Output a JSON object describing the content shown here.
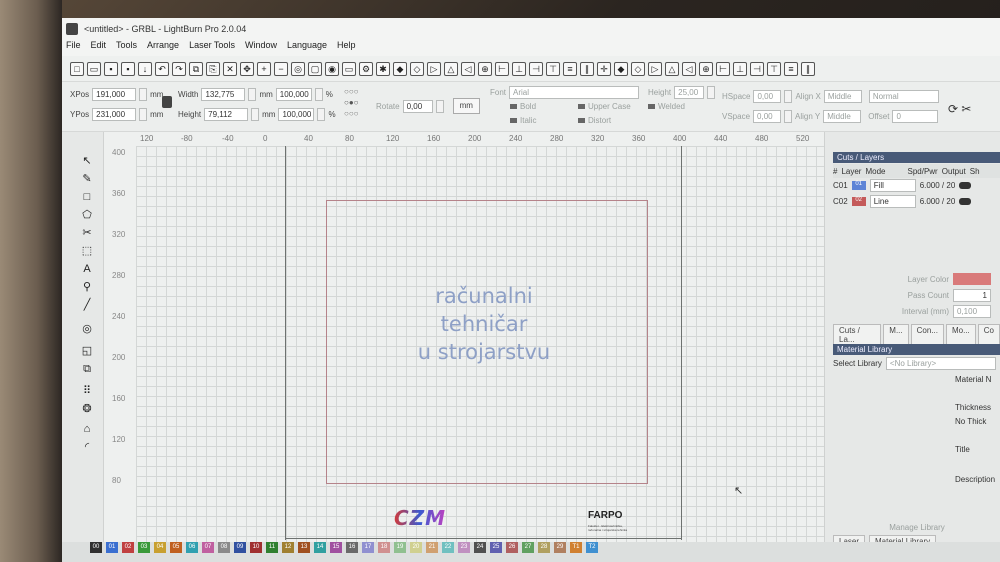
{
  "window": {
    "title": "<untitled> - GRBL - LightBurn Pro 2.0.04"
  },
  "menu": [
    "File",
    "Edit",
    "Tools",
    "Arrange",
    "Laser Tools",
    "Window",
    "Language",
    "Help"
  ],
  "props": {
    "xpos_label": "XPos",
    "xpos": "191,000",
    "ypos_label": "YPos",
    "ypos": "231,000",
    "unit": "mm",
    "width_label": "Width",
    "width": "132,775",
    "height_label": "Height",
    "height": "79,112",
    "scale_w": "100,000",
    "scale_h": "100,000",
    "percent": "%",
    "rotate_label": "Rotate",
    "rotate": "0,00",
    "mm_button": "mm",
    "font_label": "Font",
    "font": "Arial",
    "fheight_label": "Height",
    "fheight": "25,00",
    "bold": "Bold",
    "italic": "Italic",
    "upper": "Upper Case",
    "welded": "Welded",
    "distort": "Distort",
    "hspace_label": "HSpace",
    "hspace": "0,00",
    "vspace_label": "VSpace",
    "vspace": "0,00",
    "alignx_label": "Align X",
    "alignx": "Middle",
    "aligny_label": "Align Y",
    "aligny": "Middle",
    "normal": "Normal",
    "offset_label": "Offset",
    "offset": "0"
  },
  "ruler_top": [
    "120",
    "-80",
    "-40",
    "0",
    "40",
    "80",
    "120",
    "160",
    "200",
    "240",
    "280",
    "320",
    "360",
    "400",
    "440",
    "480",
    "520"
  ],
  "ruler_left": [
    "400",
    "360",
    "320",
    "280",
    "240",
    "200",
    "160",
    "120",
    "80"
  ],
  "design": {
    "text_lines": [
      "računalni",
      "tehničar",
      "u strojarstvu"
    ],
    "logo_czm": "CZM",
    "logo_farpo": "FARPO",
    "logo_farpo_sub": "Fakultet - Elektrotehnička, računalna i strojarska tehnika"
  },
  "cuts": {
    "title": "Cuts / Layers",
    "headers": [
      "#",
      "Layer",
      "Mode",
      "Spd/Pwr",
      "Output",
      "Sh"
    ],
    "rows": [
      {
        "id": "C01",
        "layer": "01",
        "mode": "Fill",
        "spd": "6.000 / 20",
        "color": "#5d84d6"
      },
      {
        "id": "C02",
        "layer": "02",
        "mode": "Line",
        "spd": "6.000 / 20",
        "color": "#c45a5a"
      }
    ],
    "layer_color_label": "Layer Color",
    "pass_count_label": "Pass Count",
    "pass_count": "1",
    "interval_label": "Interval (mm)",
    "interval": "0,100"
  },
  "panel_tabs": [
    "Cuts / La...",
    "M...",
    "Con...",
    "Mo...",
    "Co"
  ],
  "material": {
    "title": "Material Library",
    "select_label": "Select Library",
    "select_value": "<No Library>",
    "material_label": "Material N",
    "thickness_label": "Thickness",
    "no_thick": "No Thick",
    "title_label": "Title",
    "desc_label": "Description",
    "manage": "Manage Library",
    "tab_laser": "Laser",
    "tab_lib": "Material Library"
  },
  "palette": [
    {
      "n": "00",
      "c": "#303030"
    },
    {
      "n": "01",
      "c": "#3a6fd0"
    },
    {
      "n": "02",
      "c": "#c04040"
    },
    {
      "n": "03",
      "c": "#3a9a3a"
    },
    {
      "n": "04",
      "c": "#c8a030"
    },
    {
      "n": "05",
      "c": "#c06020"
    },
    {
      "n": "06",
      "c": "#30a0b0"
    },
    {
      "n": "07",
      "c": "#c060a0"
    },
    {
      "n": "08",
      "c": "#8a8a8a"
    },
    {
      "n": "09",
      "c": "#3050a0"
    },
    {
      "n": "10",
      "c": "#a03030"
    },
    {
      "n": "11",
      "c": "#308030"
    },
    {
      "n": "12",
      "c": "#a08030"
    },
    {
      "n": "13",
      "c": "#a05020"
    },
    {
      "n": "14",
      "c": "#30a0a0"
    },
    {
      "n": "15",
      "c": "#a050a0"
    },
    {
      "n": "16",
      "c": "#6a6a6a"
    },
    {
      "n": "17",
      "c": "#9090d0"
    },
    {
      "n": "18",
      "c": "#d09090"
    },
    {
      "n": "19",
      "c": "#90c090"
    },
    {
      "n": "20",
      "c": "#d0d090"
    },
    {
      "n": "21",
      "c": "#d0a070"
    },
    {
      "n": "22",
      "c": "#70c0c0"
    },
    {
      "n": "23",
      "c": "#c090c0"
    },
    {
      "n": "24",
      "c": "#505050"
    },
    {
      "n": "25",
      "c": "#6060b0"
    },
    {
      "n": "26",
      "c": "#b06060"
    },
    {
      "n": "27",
      "c": "#60a060"
    },
    {
      "n": "28",
      "c": "#b0a060"
    },
    {
      "n": "29",
      "c": "#b08060"
    },
    {
      "n": "T1",
      "c": "#d08030"
    },
    {
      "n": "T2",
      "c": "#4090d0"
    }
  ]
}
